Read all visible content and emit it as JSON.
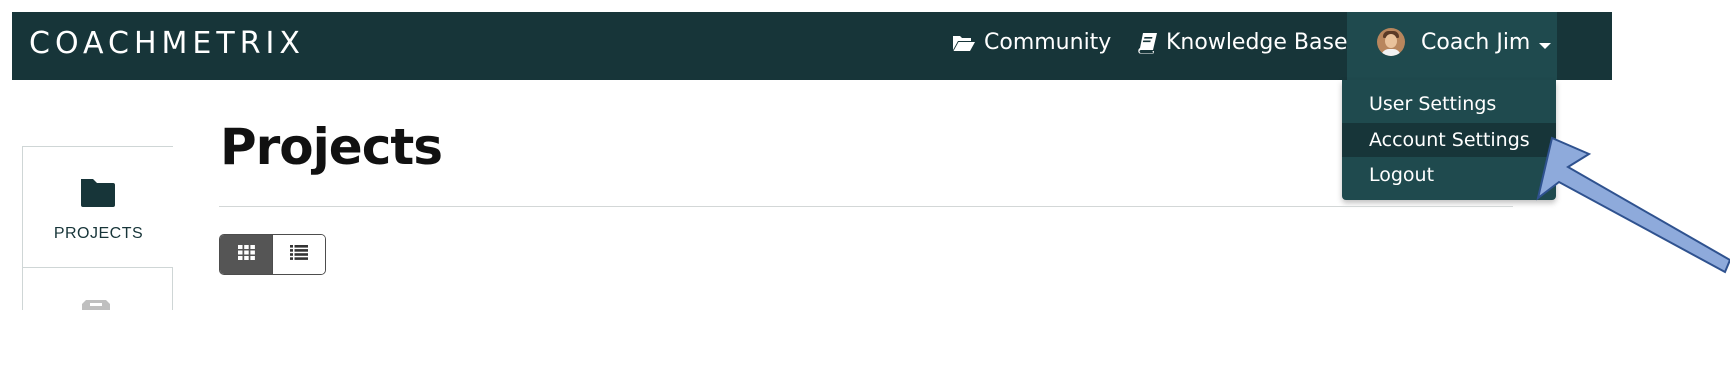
{
  "navbar": {
    "brand": "COACHMETRIX",
    "links": [
      {
        "label": "Community",
        "icon": "folder-open-icon"
      },
      {
        "label": "Knowledge Base",
        "icon": "book-icon"
      }
    ],
    "user": {
      "name": "Coach Jim",
      "avatar": "avatar"
    }
  },
  "user_menu": {
    "items": [
      {
        "label": "User Settings",
        "active": false
      },
      {
        "label": "Account Settings",
        "active": true
      },
      {
        "label": "Logout",
        "active": false
      }
    ]
  },
  "sidebar": {
    "items": [
      {
        "label": "PROJECTS",
        "icon": "folder-icon"
      }
    ]
  },
  "main": {
    "title": "Projects",
    "view_toggle": {
      "active": "grid",
      "options": [
        "grid",
        "list"
      ]
    }
  },
  "colors": {
    "navbar_bg": "#173539",
    "menu_bg": "#1f4a4e",
    "active_bg": "#173539",
    "arrow_fill": "#8eaadb",
    "arrow_stroke": "#2f528f"
  }
}
